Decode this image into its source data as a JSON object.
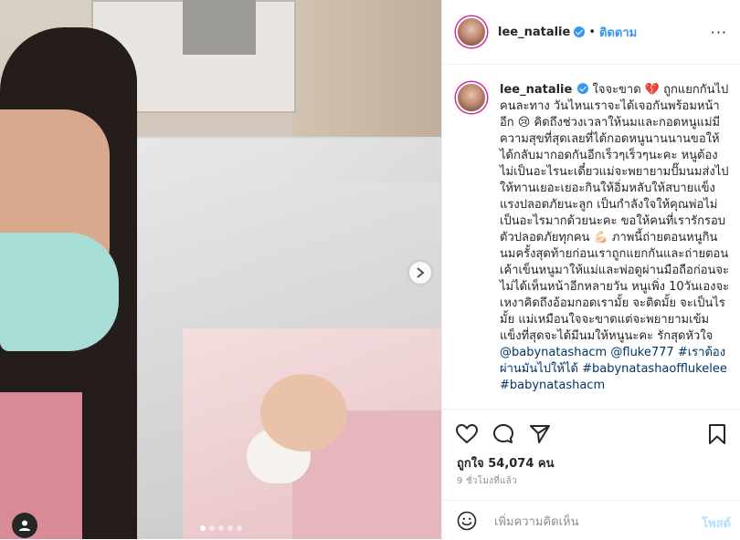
{
  "header": {
    "username": "lee_natalie",
    "separator": "•",
    "follow_label": "ติดตาม",
    "more_label": "···"
  },
  "caption": {
    "username": "lee_natalie",
    "text": "ใจจะขาด 💔 ถูกแยกกันไปคนละทาง วันไหนเราจะได้เจอกันพร้อมหน้าอีก 😢 คิดถึงช่วงเวลาให้นมและกอดหนูแม่มีความสุขที่สุดเลยที่ได้กอดหนูนานนานขอให้ได้กลับมากอดกันอีกเร็วๆเร็วๆนะคะ หนูต้องไม่เป็นอะไรนะเดี๋ยวแม่จะพยายามปั๊มนมส่งไปให้ทานเยอะเยอะกินให้อิ่มหลับให้สบายแข็งแรงปลอดภัยนะลูก เป็นกำลังใจให้คุณพ่อไม่เป็นอะไรมากด้วยนะคะ ขอให้คนที่เรารักรอบตัวปลอดภัยทุกคน 💪🏻 ภาพนี้ถ่ายตอนหนูกินนมครั้งสุดท้ายก่อนเราถูกแยกกันและถ่ายตอนเค้าเข็นหนูมาให้แม่และพ่อดูผ่านมือถือก่อนจะไม่ได้เห็นหน้าอีกหลายวัน หนูเพิ่ง 10วันเองจะเหงาคิดถึงอ้อมกอดเรามั้ย จะติดมั้ย จะเป็นไรมั้ย แม่เหมือนใจจะขาดแต่จะพยายามเข้มแข็งที่สุดจะได้มีนมให้หนูนะคะ รักสุดหัวใจ",
    "mentions": [
      "@babynatashacm",
      "@fluke777",
      "#เราต้องผ่านมันไปให้ได้",
      "#babynatashaofflukelee",
      "#babynatashacm"
    ]
  },
  "actions": {
    "like_icon": "heart-icon",
    "comment_icon": "comment-icon",
    "share_icon": "share-icon",
    "save_icon": "bookmark-icon"
  },
  "likes_text": "ถูกใจ 54,074 คน",
  "timestamp": "9 ชั่วโมงที่แล้ว",
  "comment": {
    "placeholder": "เพิ่มความคิดเห็น",
    "post_label": "โพสต์"
  },
  "carousel": {
    "total": 5,
    "active": 1
  },
  "colors": {
    "link": "#003569",
    "follow": "#3897f0",
    "verified": "#3897f0"
  }
}
